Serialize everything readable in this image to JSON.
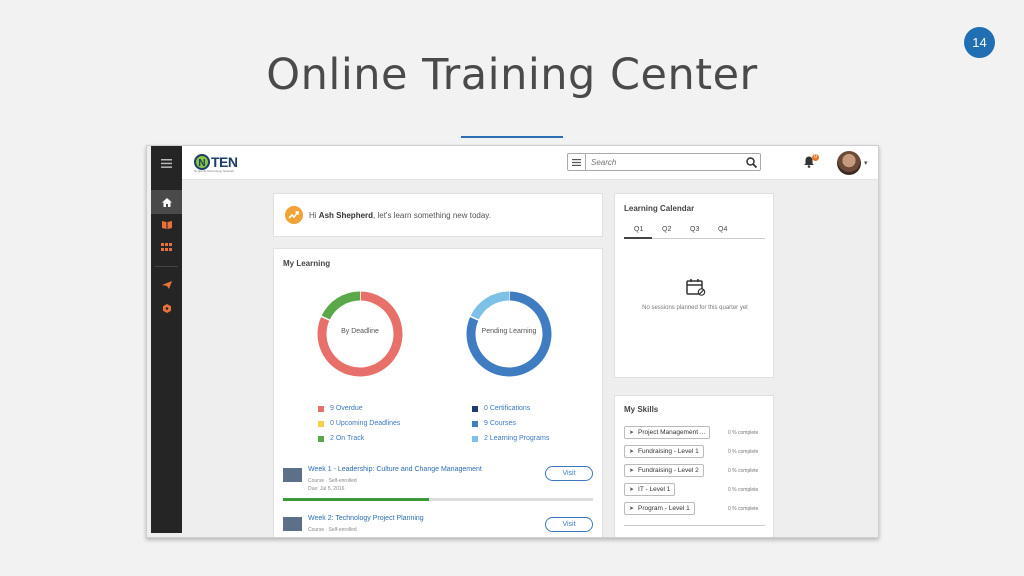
{
  "slide": {
    "number": "14",
    "title": "Online Training Center"
  },
  "app": {
    "logo_text": "TEN",
    "logo_n": "N",
    "logo_sub": "Nonprofit Technology Network",
    "search_placeholder": "Search",
    "notification_count": "0"
  },
  "sidebar": {
    "items": [
      {
        "icon": "home-icon",
        "active": true
      },
      {
        "icon": "book-icon",
        "active": false
      },
      {
        "icon": "grid-icon",
        "active": false
      },
      {
        "icon": "plane-icon",
        "active": false
      },
      {
        "icon": "badge-icon",
        "active": false
      }
    ]
  },
  "greeting": {
    "prefix": "Hi",
    "name": "Ash Shepherd",
    "suffix": ", let's learn something new today."
  },
  "my_learning": {
    "title": "My Learning",
    "chart_data": [
      {
        "type": "pie",
        "title": "By Deadline",
        "categories": [
          "Overdue",
          "Upcoming Deadlines",
          "On Track"
        ],
        "values": [
          9,
          0,
          2
        ],
        "colors": [
          "#e8706a",
          "#f5d14a",
          "#5aa84a"
        ]
      },
      {
        "type": "pie",
        "title": "Pending Learning",
        "categories": [
          "Certifications",
          "Courses",
          "Learning Programs"
        ],
        "values": [
          0,
          9,
          2
        ],
        "colors": [
          "#1e3d6e",
          "#3f7cc2",
          "#7ec1e6"
        ]
      }
    ],
    "legend_left": [
      {
        "label": "9 Overdue",
        "color": "#e8706a"
      },
      {
        "label": "0 Upcoming Deadlines",
        "color": "#f5d14a"
      },
      {
        "label": "2 On Track",
        "color": "#5aa84a"
      }
    ],
    "legend_right": [
      {
        "label": "0 Certifications",
        "color": "#1e3d6e"
      },
      {
        "label": "9 Courses",
        "color": "#3f7cc2"
      },
      {
        "label": "2 Learning Programs",
        "color": "#7ec1e6"
      }
    ],
    "courses": [
      {
        "title": "Week 1 - Leadership: Culture and Change Management",
        "type": "Course · Self-enrolled",
        "due": "Due: Jul 5, 2016",
        "progress": 0.47,
        "action": "Visit"
      },
      {
        "title": "Week 2: Technology Project Planning",
        "type": "Course · Self-enrolled",
        "action": "Visit"
      }
    ]
  },
  "calendar": {
    "title": "Learning Calendar",
    "tabs": [
      "Q1",
      "Q2",
      "Q3",
      "Q4"
    ],
    "active_tab": "Q1",
    "empty_message": "No sessions planned for this quarter yet"
  },
  "skills": {
    "title": "My Skills",
    "items": [
      {
        "name": "Project Management ...",
        "complete": "0 % complete"
      },
      {
        "name": "Fundraising - Level 1",
        "complete": "0 % complete"
      },
      {
        "name": "Fundraising - Level 2",
        "complete": "0 % complete"
      },
      {
        "name": "IT - Level 1",
        "complete": "0 % complete"
      },
      {
        "name": "Program - Level 1",
        "complete": "0 % complete"
      }
    ]
  }
}
